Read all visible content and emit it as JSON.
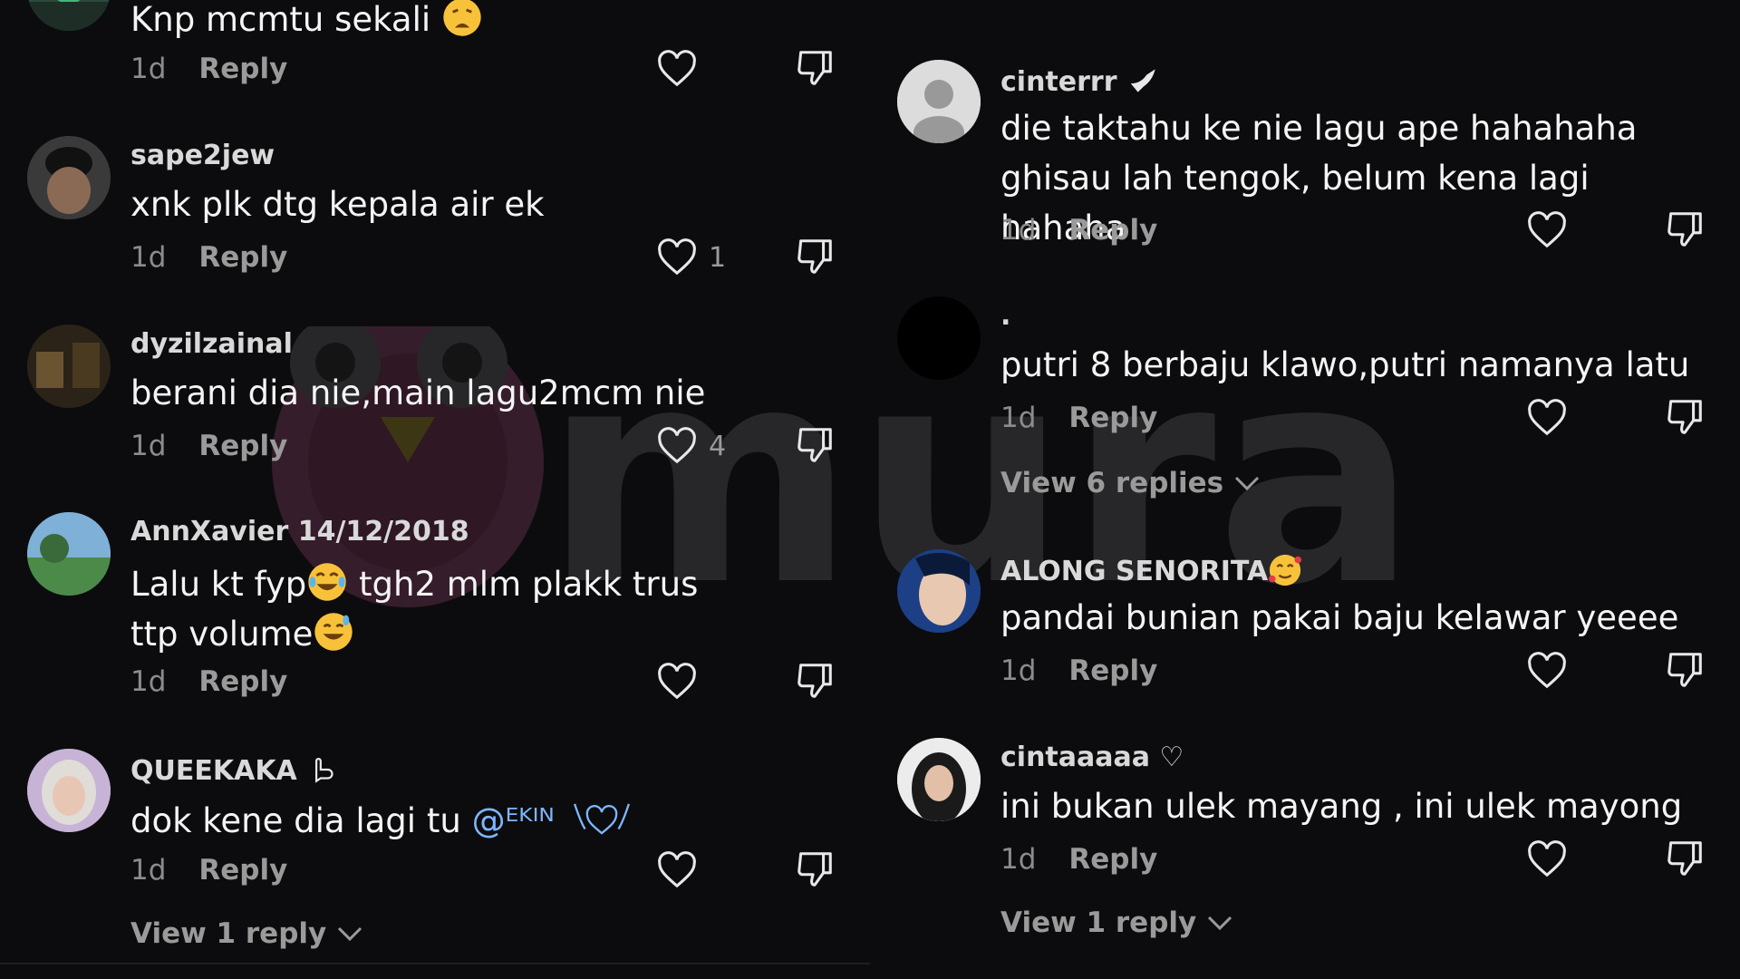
{
  "watermark": "murai",
  "left_column": {
    "top_comment": {
      "text": "Knp mcmtu sekali",
      "time": "1d",
      "reply": "Reply"
    },
    "comments": [
      {
        "username": "sape2jew",
        "text": "xnk plk dtg kepala air ek",
        "time": "1d",
        "reply": "Reply",
        "likes": "1"
      },
      {
        "username": "dyzilzainal",
        "text": "berani dia nie,main lagu2mcm nie",
        "time": "1d",
        "reply": "Reply",
        "likes": "4"
      },
      {
        "username": "AnnXavier 14/12/2018",
        "text_part1": "Lalu kt fyp",
        "text_part2": " tgh2 mlm plakk trus ttp volume",
        "time": "1d",
        "reply": "Reply"
      },
      {
        "username": "QUEEKAKA",
        "text": "dok kene dia lagi tu ",
        "mention": "@ᴱᴷᴵᴺ",
        "time": "1d",
        "reply": "Reply",
        "view_replies": "View 1 reply"
      }
    ]
  },
  "right_column": {
    "comments": [
      {
        "username": "cinterrr",
        "text": "die taktahu ke nie lagu ape hahahaha ghisau lah tengok, belum kena lagi hahaha",
        "time": "1d",
        "reply": "Reply"
      },
      {
        "username": ".",
        "text": "putri 8 berbaju klawo,putri namanya latu",
        "time": "1d",
        "reply": "Reply",
        "view_replies": "View 6 replies"
      },
      {
        "username": "ALONG SENORITA",
        "text": "pandai bunian pakai baju kelawar yeeee",
        "time": "1d",
        "reply": "Reply"
      },
      {
        "username": "cintaaaaa ♡",
        "text": "ini bukan ulek mayang , ini ulek mayong",
        "time": "1d",
        "reply": "Reply",
        "view_replies": "View 1 reply"
      }
    ]
  },
  "colors": {
    "background": "#0c0c0e",
    "text": "#f4f4f4",
    "muted": "#8c8c8c",
    "mention": "#7eb6ff"
  }
}
